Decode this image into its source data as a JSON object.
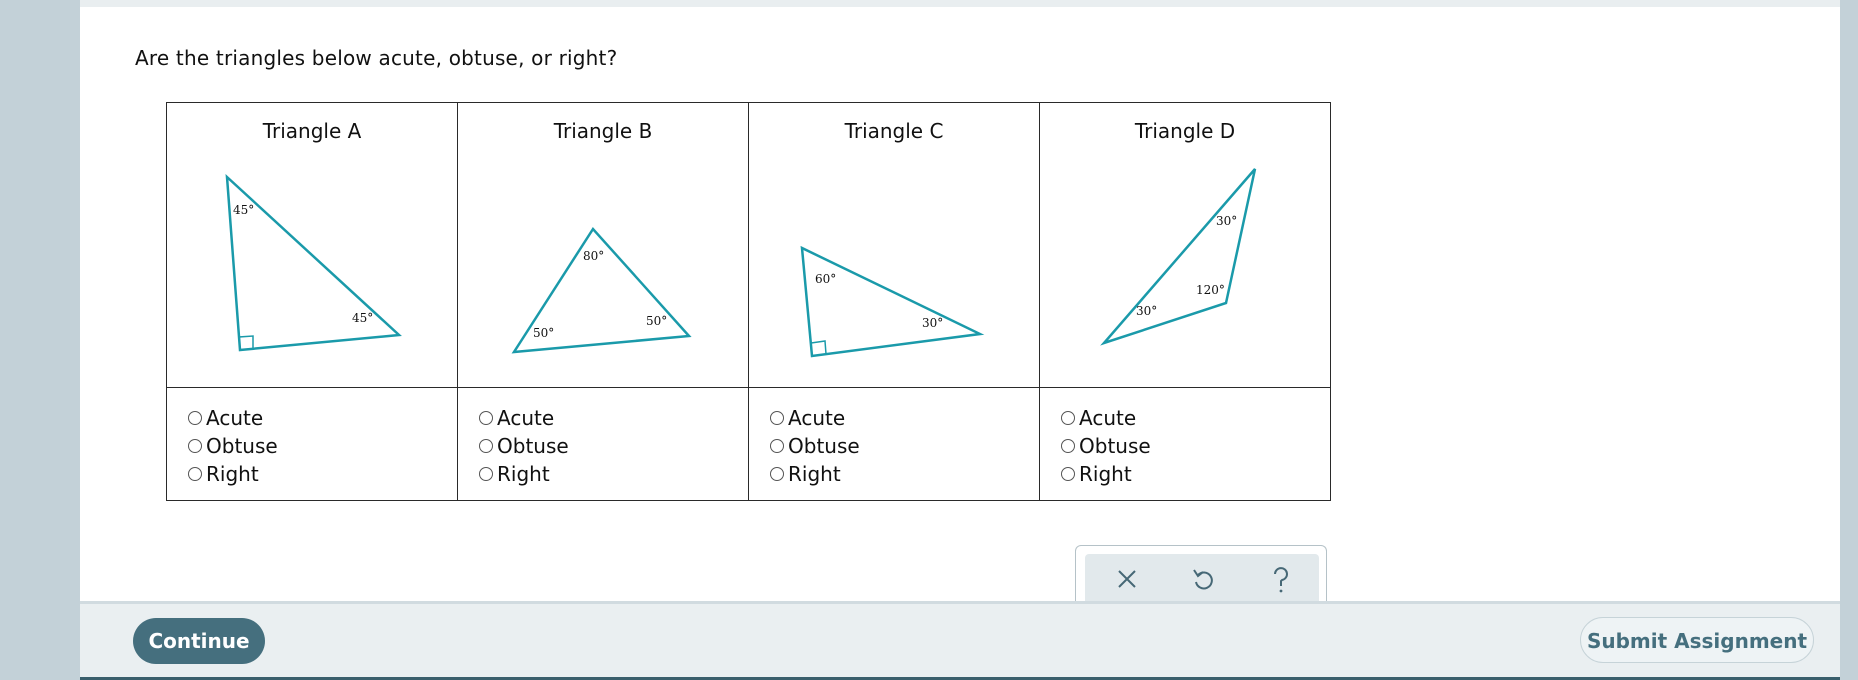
{
  "question": "Are the triangles below acute, obtuse, or right?",
  "triangles": [
    {
      "title": "Triangle A",
      "angles": [
        "45°",
        "45°"
      ],
      "options": [
        "Acute",
        "Obtuse",
        "Right"
      ]
    },
    {
      "title": "Triangle B",
      "angles": [
        "80°",
        "50°",
        "50°"
      ],
      "options": [
        "Acute",
        "Obtuse",
        "Right"
      ]
    },
    {
      "title": "Triangle C",
      "angles": [
        "60°",
        "30°"
      ],
      "options": [
        "Acute",
        "Obtuse",
        "Right"
      ]
    },
    {
      "title": "Triangle D",
      "angles": [
        "30°",
        "120°",
        "30°"
      ],
      "options": [
        "Acute",
        "Obtuse",
        "Right"
      ]
    }
  ],
  "tools": [
    "close-icon",
    "undo-icon",
    "help-icon"
  ],
  "footer": {
    "continue_label": "Continue",
    "submit_label": "Submit Assignment"
  },
  "colors": {
    "triangle_stroke": "#1a9aaa",
    "primary_button": "#456f7e",
    "side_background": "#c3d1d8"
  }
}
